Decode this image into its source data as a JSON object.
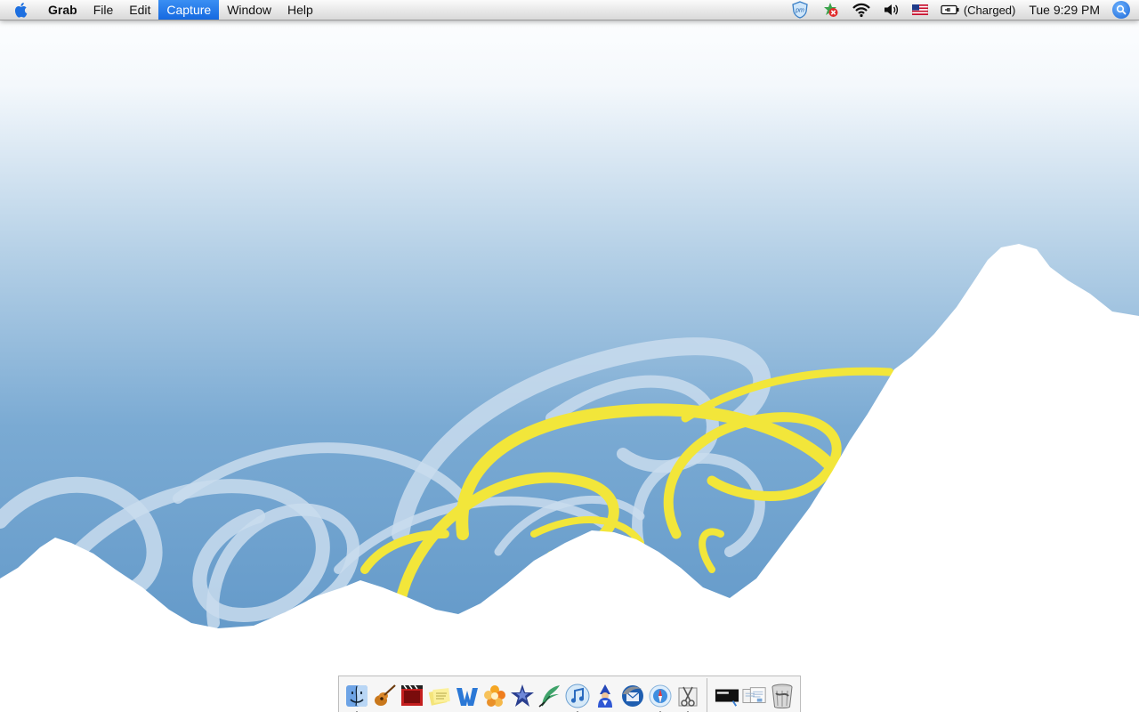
{
  "menubar": {
    "app_name": "Grab",
    "menus": [
      {
        "label": "File",
        "active": false
      },
      {
        "label": "Edit",
        "active": false
      },
      {
        "label": "Capture",
        "active": true
      },
      {
        "label": "Window",
        "active": false
      },
      {
        "label": "Help",
        "active": false
      }
    ],
    "status": {
      "battery_text": "(Charged)",
      "clock": "Tue 9:29 PM"
    },
    "colors": {
      "active_menu": "#1a6fe5"
    }
  },
  "status_icons": [
    "pm-shield-icon",
    "shield-x-icon",
    "wifi-icon",
    "volume-icon",
    "us-flag-icon",
    "battery-icon",
    "spotlight-icon"
  ],
  "dock": {
    "apps": [
      {
        "name": "finder-icon",
        "running": true
      },
      {
        "name": "garageband-icon",
        "running": false
      },
      {
        "name": "movie-clapper-icon",
        "running": false
      },
      {
        "name": "stickies-icon",
        "running": false
      },
      {
        "name": "word-icon",
        "running": false
      },
      {
        "name": "photo-flower-icon",
        "running": false
      },
      {
        "name": "imovie-star-icon",
        "running": false
      },
      {
        "name": "feather-pen-icon",
        "running": false
      },
      {
        "name": "itunes-icon",
        "running": true
      },
      {
        "name": "blue-wizard-icon",
        "running": false
      },
      {
        "name": "thunderbird-icon",
        "running": false
      },
      {
        "name": "safari-icon",
        "running": true
      },
      {
        "name": "grab-scissors-icon",
        "running": true
      }
    ],
    "others": [
      {
        "name": "terminal-doc-icon"
      },
      {
        "name": "documents-stack-icon"
      },
      {
        "name": "trash-icon"
      }
    ]
  },
  "colors": {
    "sky_top": "#ffffff",
    "sky_bottom": "#5f98c8",
    "swirl_yellow": "#f2e63a",
    "swirl_light": "#c4d8ea",
    "snow": "#ffffff"
  }
}
